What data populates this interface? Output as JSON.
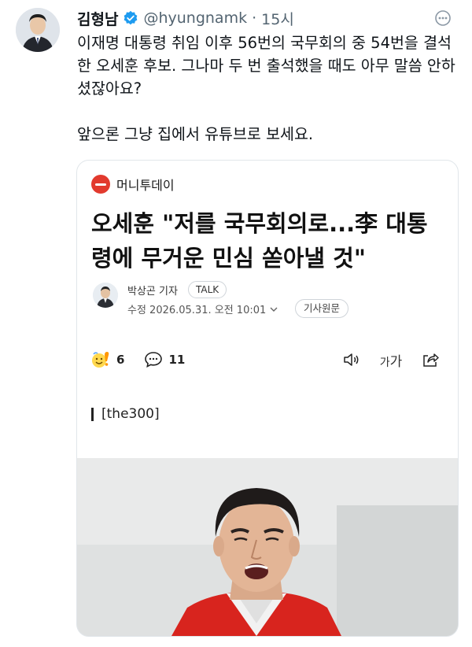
{
  "tweet": {
    "author_name": "김형남",
    "handle": "@hyungnamk",
    "separator": "·",
    "time": "15시",
    "text": "이재명 대통령 취임 이후 56번의 국무회의 중 54번을 결석한 오세훈 후보. 그나마 두 번 출석했을 때도 아무 말씀 안하셨잖아요?\n\n앞으론 그냥 집에서 유튜브로 보세요.",
    "verified_color": "#1d9bf0",
    "verified_icon": "verified-badge-icon",
    "more_icon": "more-icon"
  },
  "card": {
    "publisher": "머니투데이",
    "publisher_color": "#e23a2e",
    "headline": "오세훈 \"저를 국무회의로...李 대통령에 무거운 민심 쏟아낼 것\"",
    "reporter": "박상곤 기자",
    "talk_label": "TALK",
    "date": "수정 2026.05.31. 오전 10:01",
    "original_label": "기사원문",
    "reaction_count": "6",
    "comment_count": "11",
    "font_size_label_small": "가",
    "font_size_label_big": "가",
    "section_tag": "[the300]",
    "icons": [
      "reaction-emoji-icon",
      "comment-icon",
      "speaker-icon",
      "font-size-icon",
      "share-icon"
    ]
  }
}
